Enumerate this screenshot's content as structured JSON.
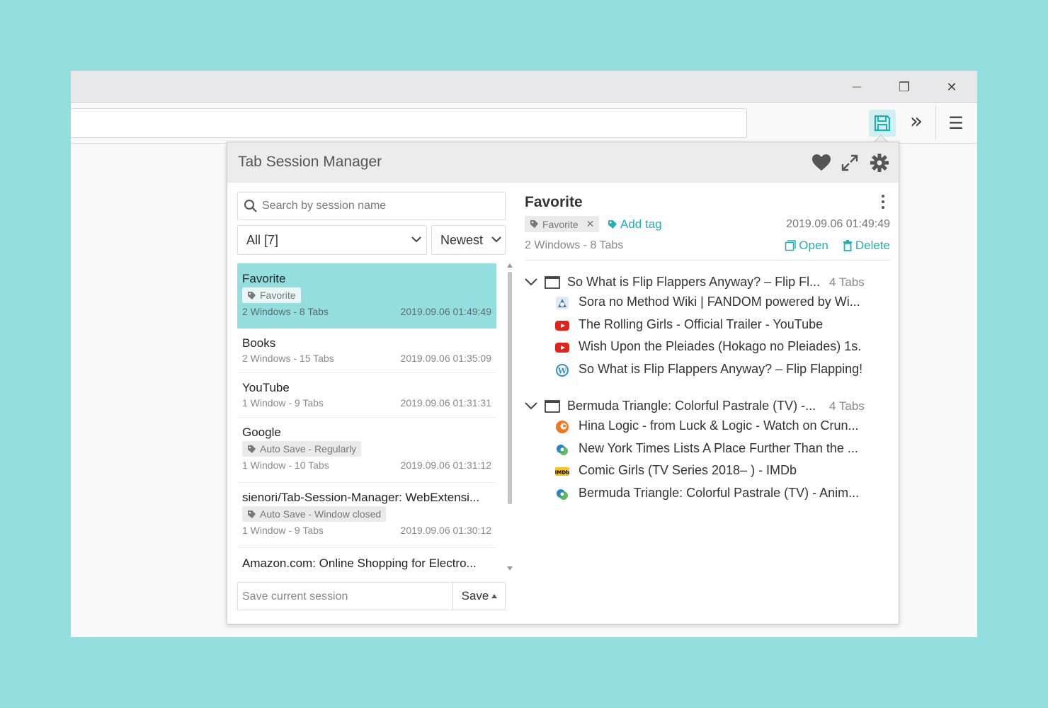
{
  "window_controls": {
    "minimize": "—",
    "restore": "❐",
    "close": "✕"
  },
  "toolbar": {
    "menu": "☰",
    "overflow": "»"
  },
  "popup": {
    "title": "Tab Session Manager",
    "search_placeholder": "Search by session name",
    "filter_value": "All [7]",
    "sort_value": "Newest",
    "save_placeholder": "Save current session",
    "save_label": "Save",
    "sessions": [
      {
        "name": "Favorite",
        "tag": "Favorite",
        "meta": "2 Windows - 8 Tabs",
        "date": "2019.09.06 01:49:49",
        "selected": true
      },
      {
        "name": "Books",
        "tag": "",
        "meta": "2 Windows - 15 Tabs",
        "date": "2019.09.06 01:35:09"
      },
      {
        "name": "YouTube",
        "tag": "",
        "meta": "1 Window - 9 Tabs",
        "date": "2019.09.06 01:31:31"
      },
      {
        "name": "Google",
        "tag": "Auto Save - Regularly",
        "meta": "1 Window - 10 Tabs",
        "date": "2019.09.06 01:31:12"
      },
      {
        "name": "sienori/Tab-Session-Manager: WebExtensi...",
        "tag": "Auto Save - Window closed",
        "meta": "1 Window - 9 Tabs",
        "date": "2019.09.06 01:30:12"
      },
      {
        "name": "Amazon.com: Online Shopping for Electro...",
        "tag": "",
        "meta": "",
        "date": ""
      }
    ],
    "detail": {
      "title": "Favorite",
      "tag": "Favorite",
      "add_tag": "Add tag",
      "date": "2019.09.06 01:49:49",
      "meta": "2 Windows - 8 Tabs",
      "open": "Open",
      "delete": "Delete",
      "windows": [
        {
          "title": "So What is Flip Flappers Anyway? – Flip Fl...",
          "count": "4 Tabs",
          "tabs": [
            {
              "title": "Sora no Method Wiki | FANDOM powered by Wi...",
              "icon": "fandom-icon"
            },
            {
              "title": "The Rolling Girls - Official Trailer - YouTube",
              "icon": "youtube-icon"
            },
            {
              "title": "Wish Upon the Pleiades (Hokago no Pleiades) 1s...",
              "icon": "youtube-icon"
            },
            {
              "title": "So What is Flip Flappers Anyway? – Flip Flapping!",
              "icon": "wordpress-icon"
            }
          ]
        },
        {
          "title": "Bermuda Triangle: Colorful Pastrale (TV) -...",
          "count": "4 Tabs",
          "tabs": [
            {
              "title": "Hina Logic - from Luck & Logic - Watch on Crun...",
              "icon": "crunchyroll-icon"
            },
            {
              "title": "New York Times Lists A Place Further Than the ...",
              "icon": "anime-news-icon"
            },
            {
              "title": "Comic Girls (TV Series 2018– ) - IMDb",
              "icon": "imdb-icon"
            },
            {
              "title": "Bermuda Triangle: Colorful Pastrale (TV) - Anim...",
              "icon": "anime-news-icon"
            }
          ]
        }
      ]
    }
  },
  "colors": {
    "accent": "#1eafb1",
    "selected_bg": "#93dfe0",
    "page_bg": "#93dfe0"
  }
}
